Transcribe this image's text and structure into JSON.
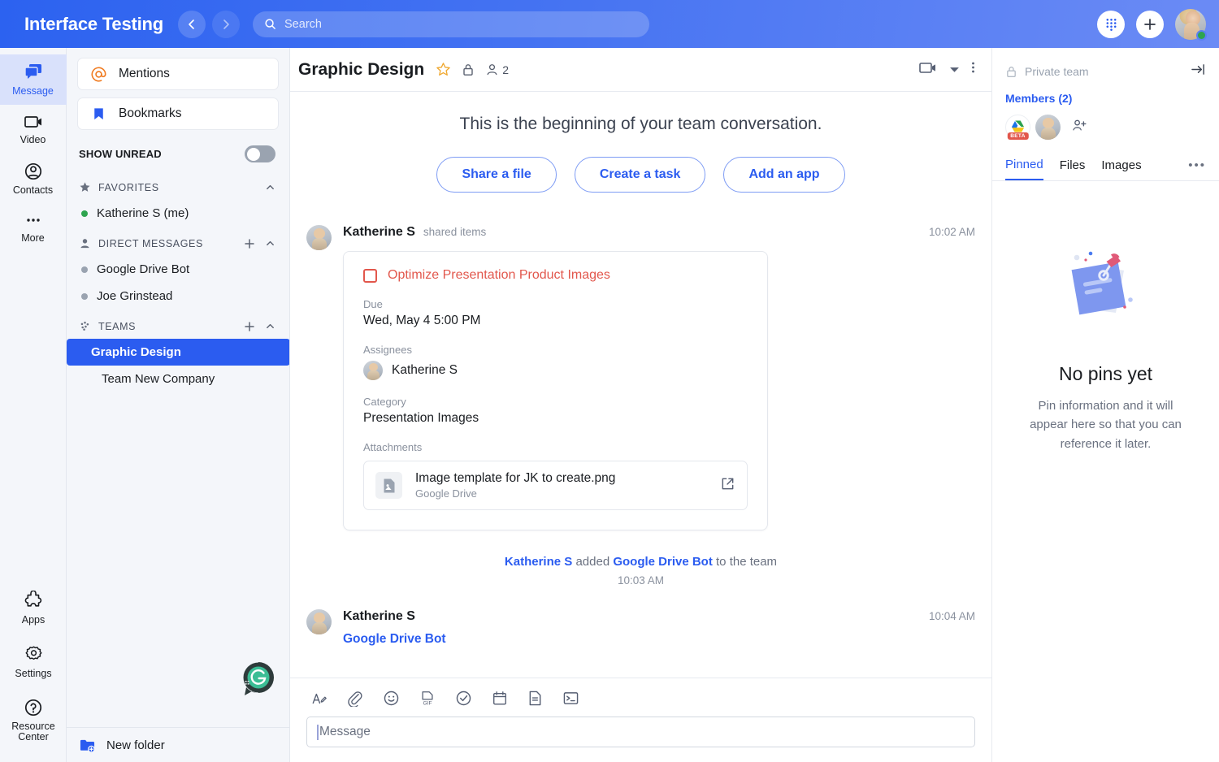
{
  "topbar": {
    "brand": "Interface Testing",
    "back_icon": "chevron-left-icon",
    "forward_icon": "chevron-right-icon",
    "search_placeholder": "Search",
    "search_value": "",
    "dialpad_icon": "dialpad-icon",
    "add_icon": "plus-icon",
    "avatar_name": "user-avatar",
    "accent": "#2b5cf0"
  },
  "rail": {
    "items": [
      {
        "label": "Message",
        "icon": "message-icon",
        "active": true
      },
      {
        "label": "Video",
        "icon": "video-camera-icon",
        "active": false
      },
      {
        "label": "Contacts",
        "icon": "contacts-icon",
        "active": false
      },
      {
        "label": "More",
        "icon": "more-dots-icon",
        "active": false
      }
    ],
    "bottom": [
      {
        "label": "Apps",
        "icon": "puzzle-icon"
      },
      {
        "label": "Settings",
        "icon": "gear-icon"
      },
      {
        "label": "Resource Center",
        "icon": "question-circle-icon"
      }
    ]
  },
  "sidebar": {
    "mentions_label": "Mentions",
    "bookmarks_label": "Bookmarks",
    "show_unread_label": "SHOW UNREAD",
    "show_unread_on": false,
    "favorites_label": "FAVORITES",
    "favorites": [
      {
        "name": "Katherine S (me)",
        "presence": "online"
      }
    ],
    "direct_messages_label": "DIRECT MESSAGES",
    "direct_messages": [
      {
        "name": "Google Drive Bot",
        "presence": "offline"
      },
      {
        "name": "Joe Grinstead",
        "presence": "offline"
      }
    ],
    "teams_label": "TEAMS",
    "teams": [
      {
        "name": "Graphic Design",
        "selected": true
      },
      {
        "name": "Team New Company",
        "selected": false
      }
    ],
    "new_folder_label": "New folder"
  },
  "conversation": {
    "title": "Graphic Design",
    "star_icon": "star-icon",
    "lock_icon": "lock-icon",
    "members_icon": "person-icon",
    "member_count": "2",
    "video_icon": "video-camera-icon",
    "chevron_icon": "chevron-down-icon",
    "more_icon": "vertical-dots-icon",
    "intro_text": "This is the beginning of your team conversation.",
    "intro_buttons": [
      "Share a file",
      "Create a task",
      "Add an app"
    ],
    "messages": [
      {
        "author": "Katherine S",
        "subtitle": "shared items",
        "time": "10:02 AM",
        "card": {
          "title": "Optimize Presentation Product Images",
          "checked": false,
          "fields": [
            {
              "label": "Due",
              "value": "Wed, May 4 5:00 PM"
            },
            {
              "label": "Assignees",
              "value": "Katherine S"
            },
            {
              "label": "Category",
              "value": "Presentation Images"
            }
          ],
          "attachments_label": "Attachments",
          "attachment": {
            "name": "Image template for JK to create.png",
            "source": "Google Drive",
            "icon": "image-file-icon",
            "open_icon": "external-link-icon"
          }
        }
      }
    ],
    "system_message": {
      "actor": "Katherine S",
      "verb": " added ",
      "target": "Google Drive Bot",
      "suffix": " to the team",
      "time": "10:03 AM"
    },
    "message2": {
      "author": "Katherine S",
      "time": "10:04 AM",
      "mention": "Google Drive Bot"
    }
  },
  "composer": {
    "tools": [
      "format-text-icon",
      "paperclip-icon",
      "emoji-icon",
      "gif-icon",
      "task-check-icon",
      "calendar-icon",
      "document-icon",
      "code-snippet-icon"
    ],
    "placeholder": "Message",
    "value": "",
    "grammarly_icon": "grammarly-icon"
  },
  "right_panel": {
    "private_icon": "lock-icon",
    "private_label": "Private team",
    "collapse_icon": "collapse-panel-icon",
    "members_label": "Members (2)",
    "member_avatars": [
      "google-drive-avatar",
      "katherine-avatar"
    ],
    "beta_badge": "BETA",
    "add_member_icon": "add-person-icon",
    "tabs": [
      {
        "label": "Pinned",
        "active": true
      },
      {
        "label": "Files",
        "active": false
      },
      {
        "label": "Images",
        "active": false
      }
    ],
    "tabs_more_icon": "horizontal-dots-icon",
    "empty_illustration": "pinned-note-illustration",
    "empty_title": "No pins yet",
    "empty_desc": "Pin information and it will appear here so that you can reference it later."
  }
}
